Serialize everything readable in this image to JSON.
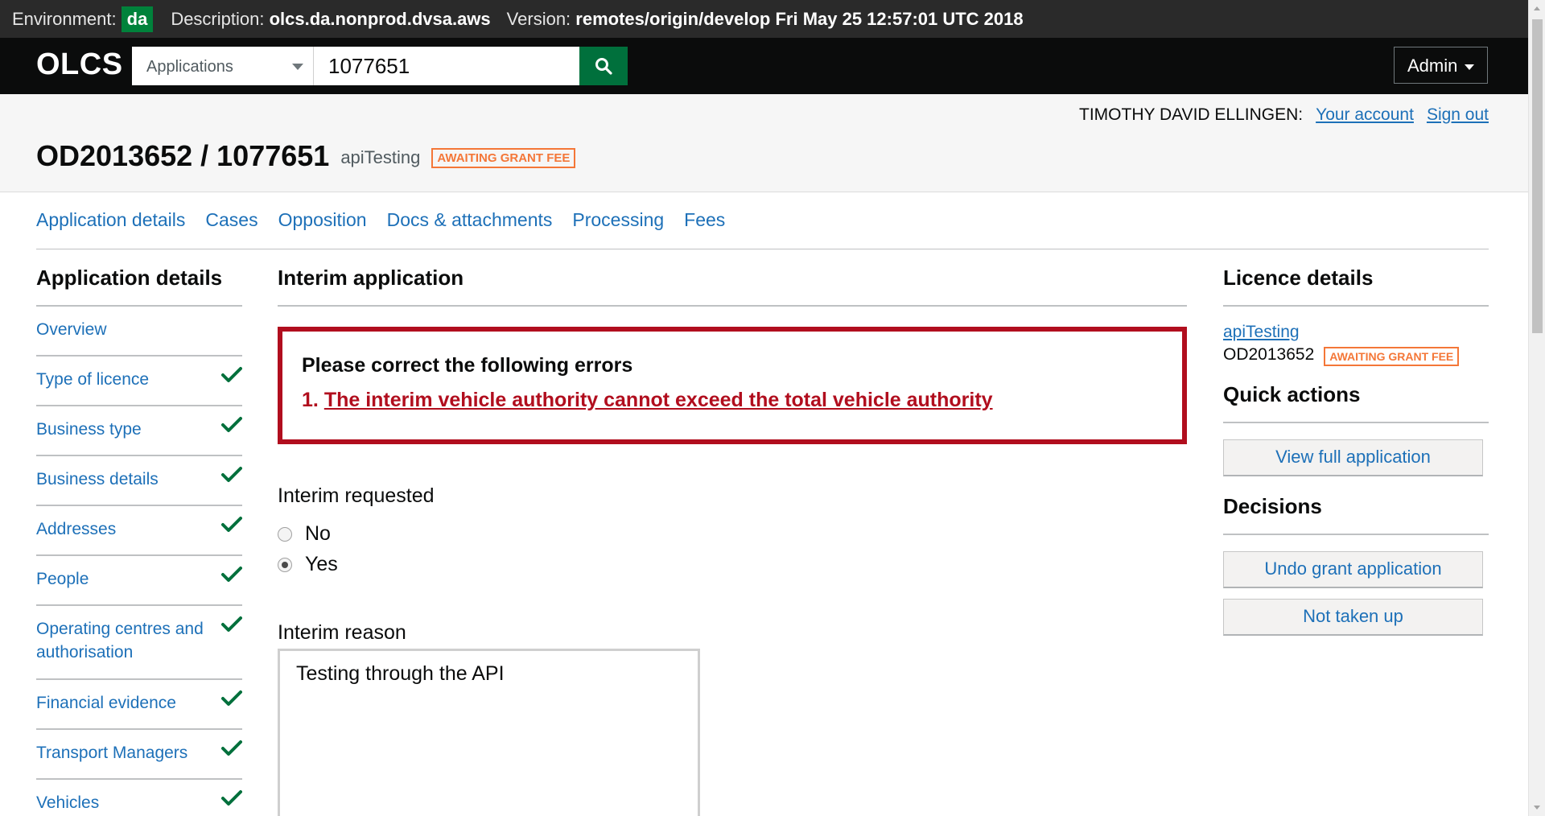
{
  "environment": {
    "env_label": "Environment:",
    "env_value": "da",
    "description_label": "Description:",
    "description_value": "olcs.da.nonprod.dvsa.aws",
    "version_label": "Version:",
    "version_value": "remotes/origin/develop Fri May 25 12:57:01 UTC 2018"
  },
  "header": {
    "logo": "OLCS",
    "search_select": "Applications",
    "search_value": "1077651",
    "search_icon": "search-icon",
    "admin_label": "Admin"
  },
  "user": {
    "name": "TIMOTHY DAVID ELLINGEN:",
    "account_link": "Your account",
    "signout_link": "Sign out"
  },
  "title": {
    "ref": "OD2013652 / 1077651",
    "subtitle": "apiTesting",
    "status": "AWAITING GRANT FEE"
  },
  "nav_tabs": [
    {
      "label": "Application details"
    },
    {
      "label": "Cases"
    },
    {
      "label": "Opposition"
    },
    {
      "label": "Docs & attachments"
    },
    {
      "label": "Processing"
    },
    {
      "label": "Fees"
    }
  ],
  "sidebar": {
    "heading": "Application details",
    "items": [
      {
        "label": "Overview",
        "complete": false
      },
      {
        "label": "Type of licence",
        "complete": true
      },
      {
        "label": "Business type",
        "complete": true
      },
      {
        "label": "Business details",
        "complete": true
      },
      {
        "label": "Addresses",
        "complete": true
      },
      {
        "label": "People",
        "complete": true
      },
      {
        "label": "Operating centres and authorisation",
        "complete": true
      },
      {
        "label": "Financial evidence",
        "complete": true
      },
      {
        "label": "Transport Managers",
        "complete": true
      },
      {
        "label": "Vehicles",
        "complete": true
      }
    ]
  },
  "main": {
    "heading": "Interim application",
    "error_title": "Please correct the following errors",
    "error_number": "1.",
    "error_message": "The interim vehicle authority cannot exceed the total vehicle authority",
    "interim_requested_label": "Interim requested",
    "radio_no": "No",
    "radio_yes": "Yes",
    "selected": "Yes",
    "interim_reason_label": "Interim reason",
    "interim_reason_value": "Testing through the API"
  },
  "right_panel": {
    "licence_heading": "Licence details",
    "licence_link": "apiTesting",
    "licence_number": "OD2013652",
    "licence_status": "AWAITING GRANT FEE",
    "quick_actions_heading": "Quick actions",
    "view_full_application": "View full application",
    "decisions_heading": "Decisions",
    "undo_grant": "Undo grant application",
    "not_taken_up": "Not taken up"
  },
  "colors": {
    "header_bg": "#0b0c0c",
    "link": "#1d70b8",
    "error": "#b10e1e",
    "status": "#f47738",
    "check": "#00703c"
  }
}
